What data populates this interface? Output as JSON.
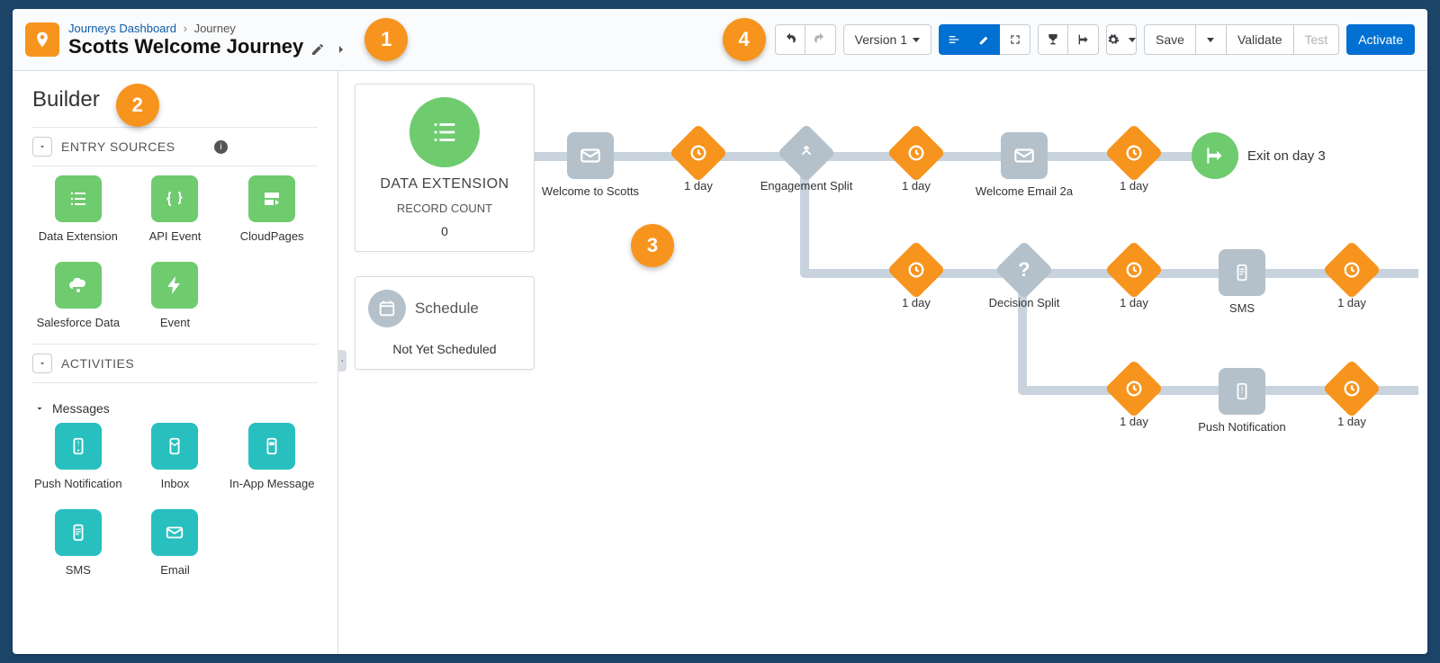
{
  "breadcrumb": {
    "root": "Journeys Dashboard",
    "leaf": "Journey"
  },
  "journey_title": "Scotts Welcome Journey",
  "annotations": {
    "a1": "1",
    "a2": "2",
    "a3": "3",
    "a4": "4"
  },
  "toolbar": {
    "version_label": "Version 1",
    "save": "Save",
    "validate": "Validate",
    "test": "Test",
    "activate": "Activate"
  },
  "sidebar": {
    "builder_title": "Builder",
    "sections": {
      "entry_sources": "ENTRY SOURCES",
      "activities": "ACTIVITIES",
      "messages": "Messages"
    },
    "entry_sources": {
      "data_extension": "Data Extension",
      "api_event": "API Event",
      "cloudpages": "CloudPages",
      "salesforce_data": "Salesforce Data",
      "event": "Event"
    },
    "messages": {
      "push": "Push Notification",
      "inbox": "Inbox",
      "inapp": "In-App Message",
      "sms": "SMS",
      "email": "Email"
    }
  },
  "canvas": {
    "data_extension_card": {
      "title": "DATA EXTENSION",
      "sub": "RECORD COUNT",
      "value": "0"
    },
    "schedule_card": {
      "title": "Schedule",
      "status": "Not Yet Scheduled"
    },
    "nodes": {
      "email1": "Welcome to Scotts",
      "wait1": "1 day",
      "split1": "Engagement Split",
      "wait2a": "1 day",
      "email2a": "Welcome Email 2a",
      "wait3a": "1 day",
      "exit1": "Exit on day 3",
      "wait2b": "1 day",
      "dsplit": "Decision Split",
      "wait3b": "1 day",
      "sms": "SMS",
      "wait4b": "1 day",
      "wait3c": "1 day",
      "push": "Push Notification",
      "wait4c": "1 day"
    }
  }
}
